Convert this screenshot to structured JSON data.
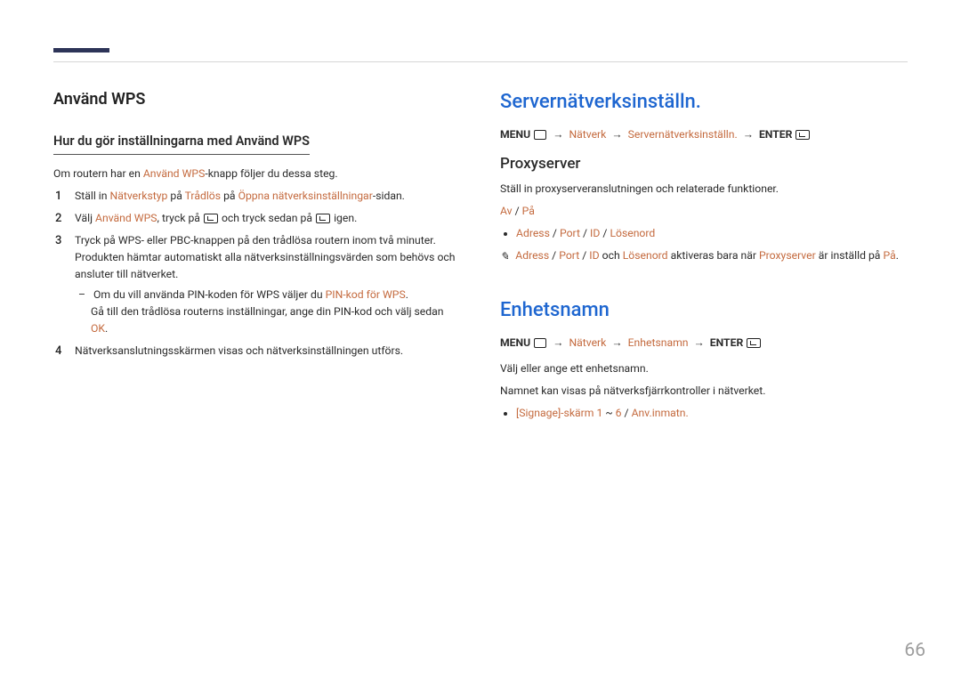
{
  "left": {
    "heading": "Använd WPS",
    "sub_heading": "Hur du gör inställningarna med Använd WPS",
    "intro_pre": "Om routern har en ",
    "intro_accent": "Använd WPS",
    "intro_post": "-knapp följer du dessa steg.",
    "step1_a": "Ställ in ",
    "step1_nt": "Nätverkstyp",
    "step1_b": " på ",
    "step1_tr": "Trådlös",
    "step1_c": " på ",
    "step1_op": "Öppna nätverksinställningar",
    "step1_d": "-sidan.",
    "step2_a": "Välj ",
    "step2_aw": "Använd WPS",
    "step2_b": ", tryck på ",
    "step2_c": " och tryck sedan på ",
    "step2_d": " igen.",
    "step3_a": "Tryck på WPS- eller PBC-knappen på den trådlösa routern inom två minuter. Produkten hämtar automatiskt alla nätverksinställningsvärden som behövs och ansluter till nätverket.",
    "step3_dash_a": "Om du vill använda PIN-koden för WPS väljer du ",
    "step3_pin": "PIN-kod för WPS",
    "step3_dash_b": ".",
    "step3_goto_a": "Gå till den trådlösa routerns inställningar, ange din PIN-kod och välj sedan ",
    "step3_ok": "OK",
    "step3_goto_b": ".",
    "step4": "Nätverksanslutningsskärmen visas och nätverksinställningen utförs."
  },
  "right": {
    "srv_heading": "Servernätverksinställn.",
    "bc_menu": "MENU",
    "bc_natverk": "Nätverk",
    "bc_srv": "Servernätverksinställn.",
    "bc_enter": "ENTER",
    "proxy_heading": "Proxyserver",
    "proxy_desc": "Ställ in proxyserveranslutningen och relaterade funktioner.",
    "av": "Av",
    "pa": "På",
    "adress": "Adress",
    "port": "Port",
    "id": "ID",
    "losen": "Lösenord",
    "note_a": " och ",
    "note_b": " aktiveras bara när ",
    "note_proxy": "Proxyserver",
    "note_c": " är inställd på ",
    "note_pa": "På",
    "note_d": ".",
    "enh_heading": "Enhetsnamn",
    "bc_enh": "Enhetsnamn",
    "enh_p1": "Välj eller ange ett enhetsnamn.",
    "enh_p2": "Namnet kan visas på nätverksfjärrkontroller i nätverket.",
    "sig_a": "[Signage]-skärm 1",
    "sig_mid": " ~ ",
    "sig_b": "6",
    "sig_sep": " / ",
    "sig_c": "Anv.inmatn."
  },
  "page_number": "66"
}
